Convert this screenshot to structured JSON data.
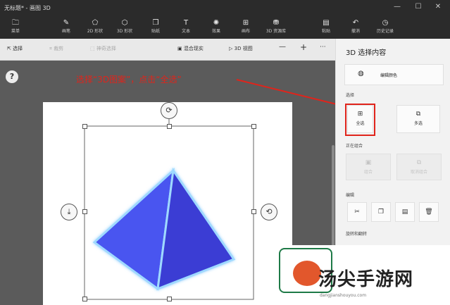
{
  "window": {
    "title": "无标题* - 画图 3D",
    "minimize": "—",
    "maximize": "☐",
    "close": "✕"
  },
  "ribbon": {
    "items": [
      {
        "label": "菜单",
        "icon": "🗀"
      },
      {
        "label": "画笔",
        "icon": "✎"
      },
      {
        "label": "2D 形状",
        "icon": "⬠"
      },
      {
        "label": "3D 形状",
        "icon": "⬡"
      },
      {
        "label": "贴纸",
        "icon": "❒"
      },
      {
        "label": "文本",
        "icon": "T"
      },
      {
        "label": "效果",
        "icon": "✺"
      },
      {
        "label": "画布",
        "icon": "⊞"
      },
      {
        "label": "3D 资源库",
        "icon": "⛃"
      },
      {
        "label": "粘贴",
        "icon": "▤"
      },
      {
        "label": "撤消",
        "icon": "↶"
      },
      {
        "label": "历史记录",
        "icon": "◷"
      }
    ]
  },
  "toolbar": {
    "select": "选择",
    "crop": "裁剪",
    "magic_select": "神奇选择",
    "mixed_reality": "混合现实",
    "view_3d": "3D 视图",
    "zoom_out": "—",
    "zoom_in": "+",
    "more": "···"
  },
  "canvas": {
    "help": "?",
    "annotation": "选择“3D图案”，点击“全选”"
  },
  "panel": {
    "title": "3D 选择内容",
    "edit_color": "编辑颜色",
    "selection_header": "选择",
    "select_all": "全选",
    "multi_select": "多选",
    "grouping_header": "正在组合",
    "group": "组合",
    "ungroup": "取消组合",
    "edit_header": "编辑",
    "rotate_flip_header": "旋转和翻转"
  },
  "watermark": {
    "text": "汤尖手游网",
    "url": "dangjianshouyou.com"
  },
  "colors": {
    "accent_red": "#e0241b",
    "pyramid": "#4a4ee8",
    "glow": "#9fd9ff"
  }
}
